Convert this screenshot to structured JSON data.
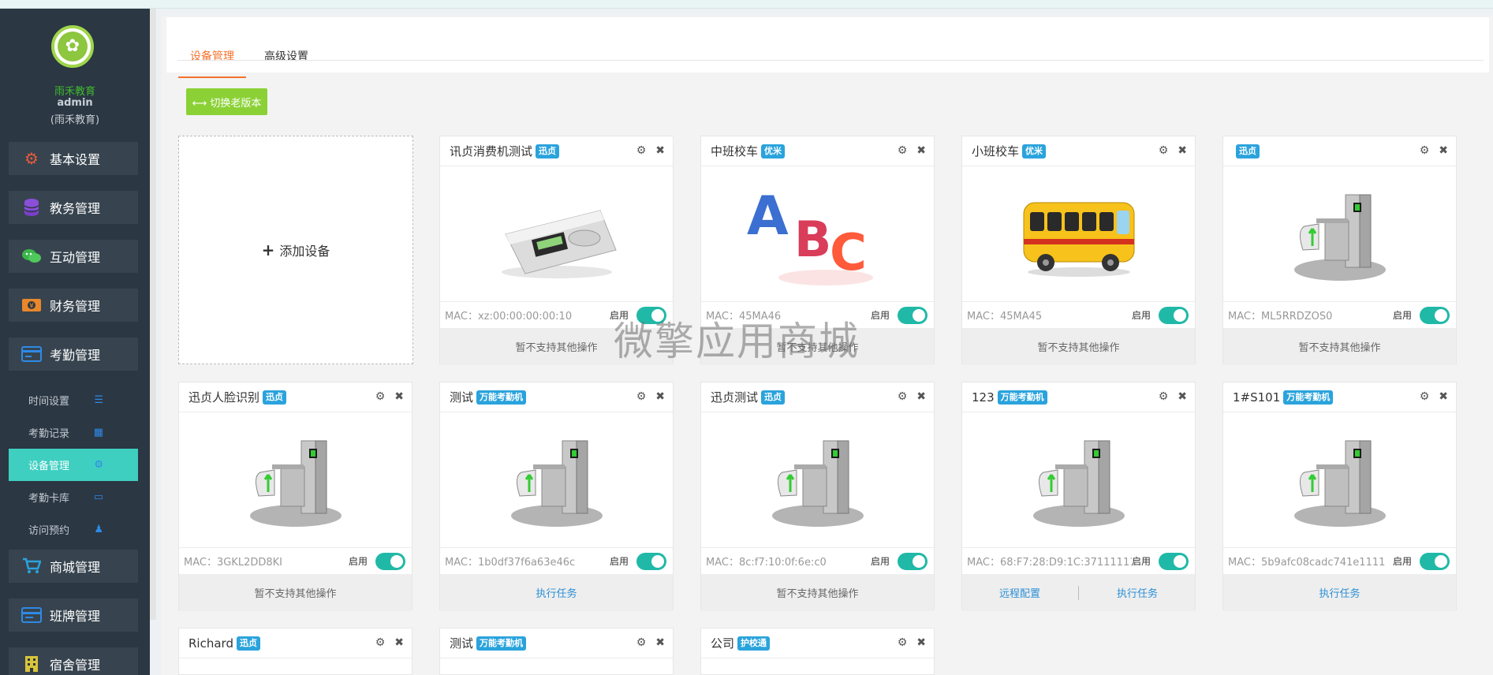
{
  "sidebar": {
    "org_name": "雨禾教育",
    "user_name": "admin",
    "user_org": "(雨禾教育)",
    "menu": {
      "basic": "基本设置",
      "teaching": "教务管理",
      "interaction": "互动管理",
      "finance": "财务管理",
      "attendance": "考勤管理",
      "mall": "商城管理",
      "class_board": "班牌管理",
      "dorm": "宿舍管理"
    },
    "submenu": {
      "time_settings": "时间设置",
      "records": "考勤记录",
      "devices": "设备管理",
      "card_library": "考勤卡库",
      "visit": "访问预约"
    }
  },
  "tabs": {
    "device_mgmt": "设备管理",
    "advanced": "高级设置"
  },
  "switch_button": "⟷ 切换老版本",
  "add_device": "添加设备",
  "enable_label": "启用",
  "actions": {
    "unsupported": "暂不支持其他操作",
    "execute": "执行任务",
    "remote_config": "远程配置"
  },
  "devices": [
    {
      "title": "讯贞消费机测试",
      "badge": "迅贞",
      "mac": "MAC：xz:00:00:00:00:10",
      "image": "pos-terminal",
      "enabled": true
    },
    {
      "title": "中班校车",
      "badge": "优米",
      "mac": "MAC：45MA46",
      "image": "abc-letters",
      "enabled": true
    },
    {
      "title": "小班校车",
      "badge": "优米",
      "mac": "MAC：45MA45",
      "image": "school-bus",
      "enabled": true
    },
    {
      "title": "",
      "badge": "迅贞",
      "mac": "MAC：ML5RRDZOS0",
      "image": "turnstile-gate",
      "enabled": true
    },
    {
      "title": "迅贞人脸识别",
      "badge": "迅贞",
      "mac": "MAC：3GKL2DD8KI",
      "image": "turnstile-gate",
      "enabled": true
    },
    {
      "title": "测试",
      "badge": "万能考勤机",
      "mac": "MAC：1b0df37f6a63e46c",
      "image": "turnstile-gate",
      "enabled": true
    },
    {
      "title": "迅贞测试",
      "badge": "迅贞",
      "mac": "MAC：8c:f7:10:0f:6e:c0",
      "image": "turnstile-gate",
      "enabled": true
    },
    {
      "title": "123",
      "badge": "万能考勤机",
      "mac": "MAC：68:F7:28:D9:1C:37111111",
      "image": "turnstile-gate",
      "enabled": true
    },
    {
      "title": "1#S101",
      "badge": "万能考勤机",
      "mac": "MAC：5b9afc08cadc741e1111",
      "image": "turnstile-gate",
      "enabled": true
    },
    {
      "title": "Richard",
      "badge": "迅贞"
    },
    {
      "title": "测试",
      "badge": "万能考勤机"
    },
    {
      "title": "公司",
      "badge": "护校通"
    }
  ],
  "watermark": "微擎应用商城",
  "colors": {
    "accent": "#f3722c",
    "sidebar": "#2b3743",
    "active": "#3fcfc1",
    "toggle": "#20b9a7",
    "badge": "#2aa3dc",
    "switch": "#8bd136"
  }
}
